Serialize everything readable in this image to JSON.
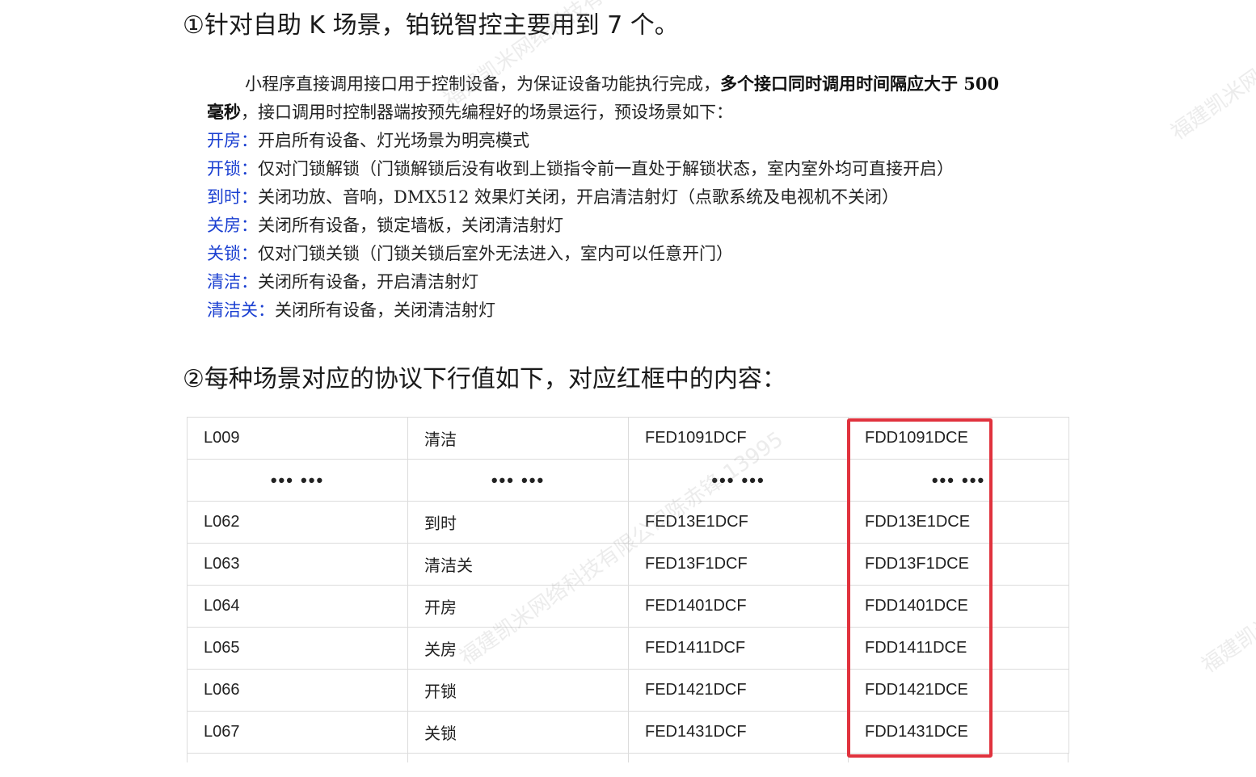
{
  "headings": {
    "h1": "①针对自助 K 场景，铂锐智控主要用到 7 个。",
    "h2": "②每种场景对应的协议下行值如下，对应红框中的内容："
  },
  "intro": {
    "line1_normal": "小程序直接调用接口用于控制设备，为保证设备功能执行完成，",
    "line1_bold": "多个接口同时调用时间隔应大于 500",
    "line2_bold": "毫秒",
    "line2_normal": "，接口调用时控制器端按预先编程好的场景运行，预设场景如下："
  },
  "scenes": [
    {
      "name": "开房：",
      "desc": "开启所有设备、灯光场景为明亮模式"
    },
    {
      "name": "开锁：",
      "desc": "仅对门锁解锁（门锁解锁后没有收到上锁指令前一直处于解锁状态，室内室外均可直接开启）"
    },
    {
      "name": "到时：",
      "desc": "关闭功放、音响，DMX512 效果灯关闭，开启清洁射灯（点歌系统及电视机不关闭）"
    },
    {
      "name": "关房：",
      "desc": "关闭所有设备，锁定墙板，关闭清洁射灯"
    },
    {
      "name": "关锁：",
      "desc": "仅对门锁关锁（门锁关锁后室外无法进入，室内可以任意开门）"
    },
    {
      "name": "清洁：",
      "desc": "关闭所有设备，开启清洁射灯"
    },
    {
      "name": "清洁关：",
      "desc": "关闭所有设备，关闭清洁射灯"
    }
  ],
  "table": {
    "rows": [
      {
        "code": "L009",
        "scene": "清洁",
        "up": "FED1091DCF",
        "down": "FDD1091DCE"
      },
      {
        "code": "•••  •••",
        "scene": "•••  •••",
        "up": "•••  •••",
        "down": "•••  •••",
        "ellipsis": true
      },
      {
        "code": "L062",
        "scene": "到时",
        "up": "FED13E1DCF",
        "down": "FDD13E1DCE"
      },
      {
        "code": "L063",
        "scene": "清洁关",
        "up": "FED13F1DCF",
        "down": "FDD13F1DCE"
      },
      {
        "code": "L064",
        "scene": "开房",
        "up": "FED1401DCF",
        "down": "FDD1401DCE"
      },
      {
        "code": "L065",
        "scene": "关房",
        "up": "FED1411DCF",
        "down": "FDD1411DCE"
      },
      {
        "code": "L066",
        "scene": "开锁",
        "up": "FED1421DCF",
        "down": "FDD1421DCE"
      },
      {
        "code": "L067",
        "scene": "关锁",
        "up": "FED1431DCF",
        "down": "FDD1431DCE"
      }
    ]
  },
  "watermark": {
    "company": "福建凯米网络科技有限公司",
    "short": "福建凯米网",
    "short2": "福建凯米",
    "mid": "福建凯米网络科技有限公司陈赤锋 13995"
  },
  "colors": {
    "scene_name": "#1a3fd1",
    "highlight_box": "#e0323d",
    "grid": "#dcdcdc"
  }
}
